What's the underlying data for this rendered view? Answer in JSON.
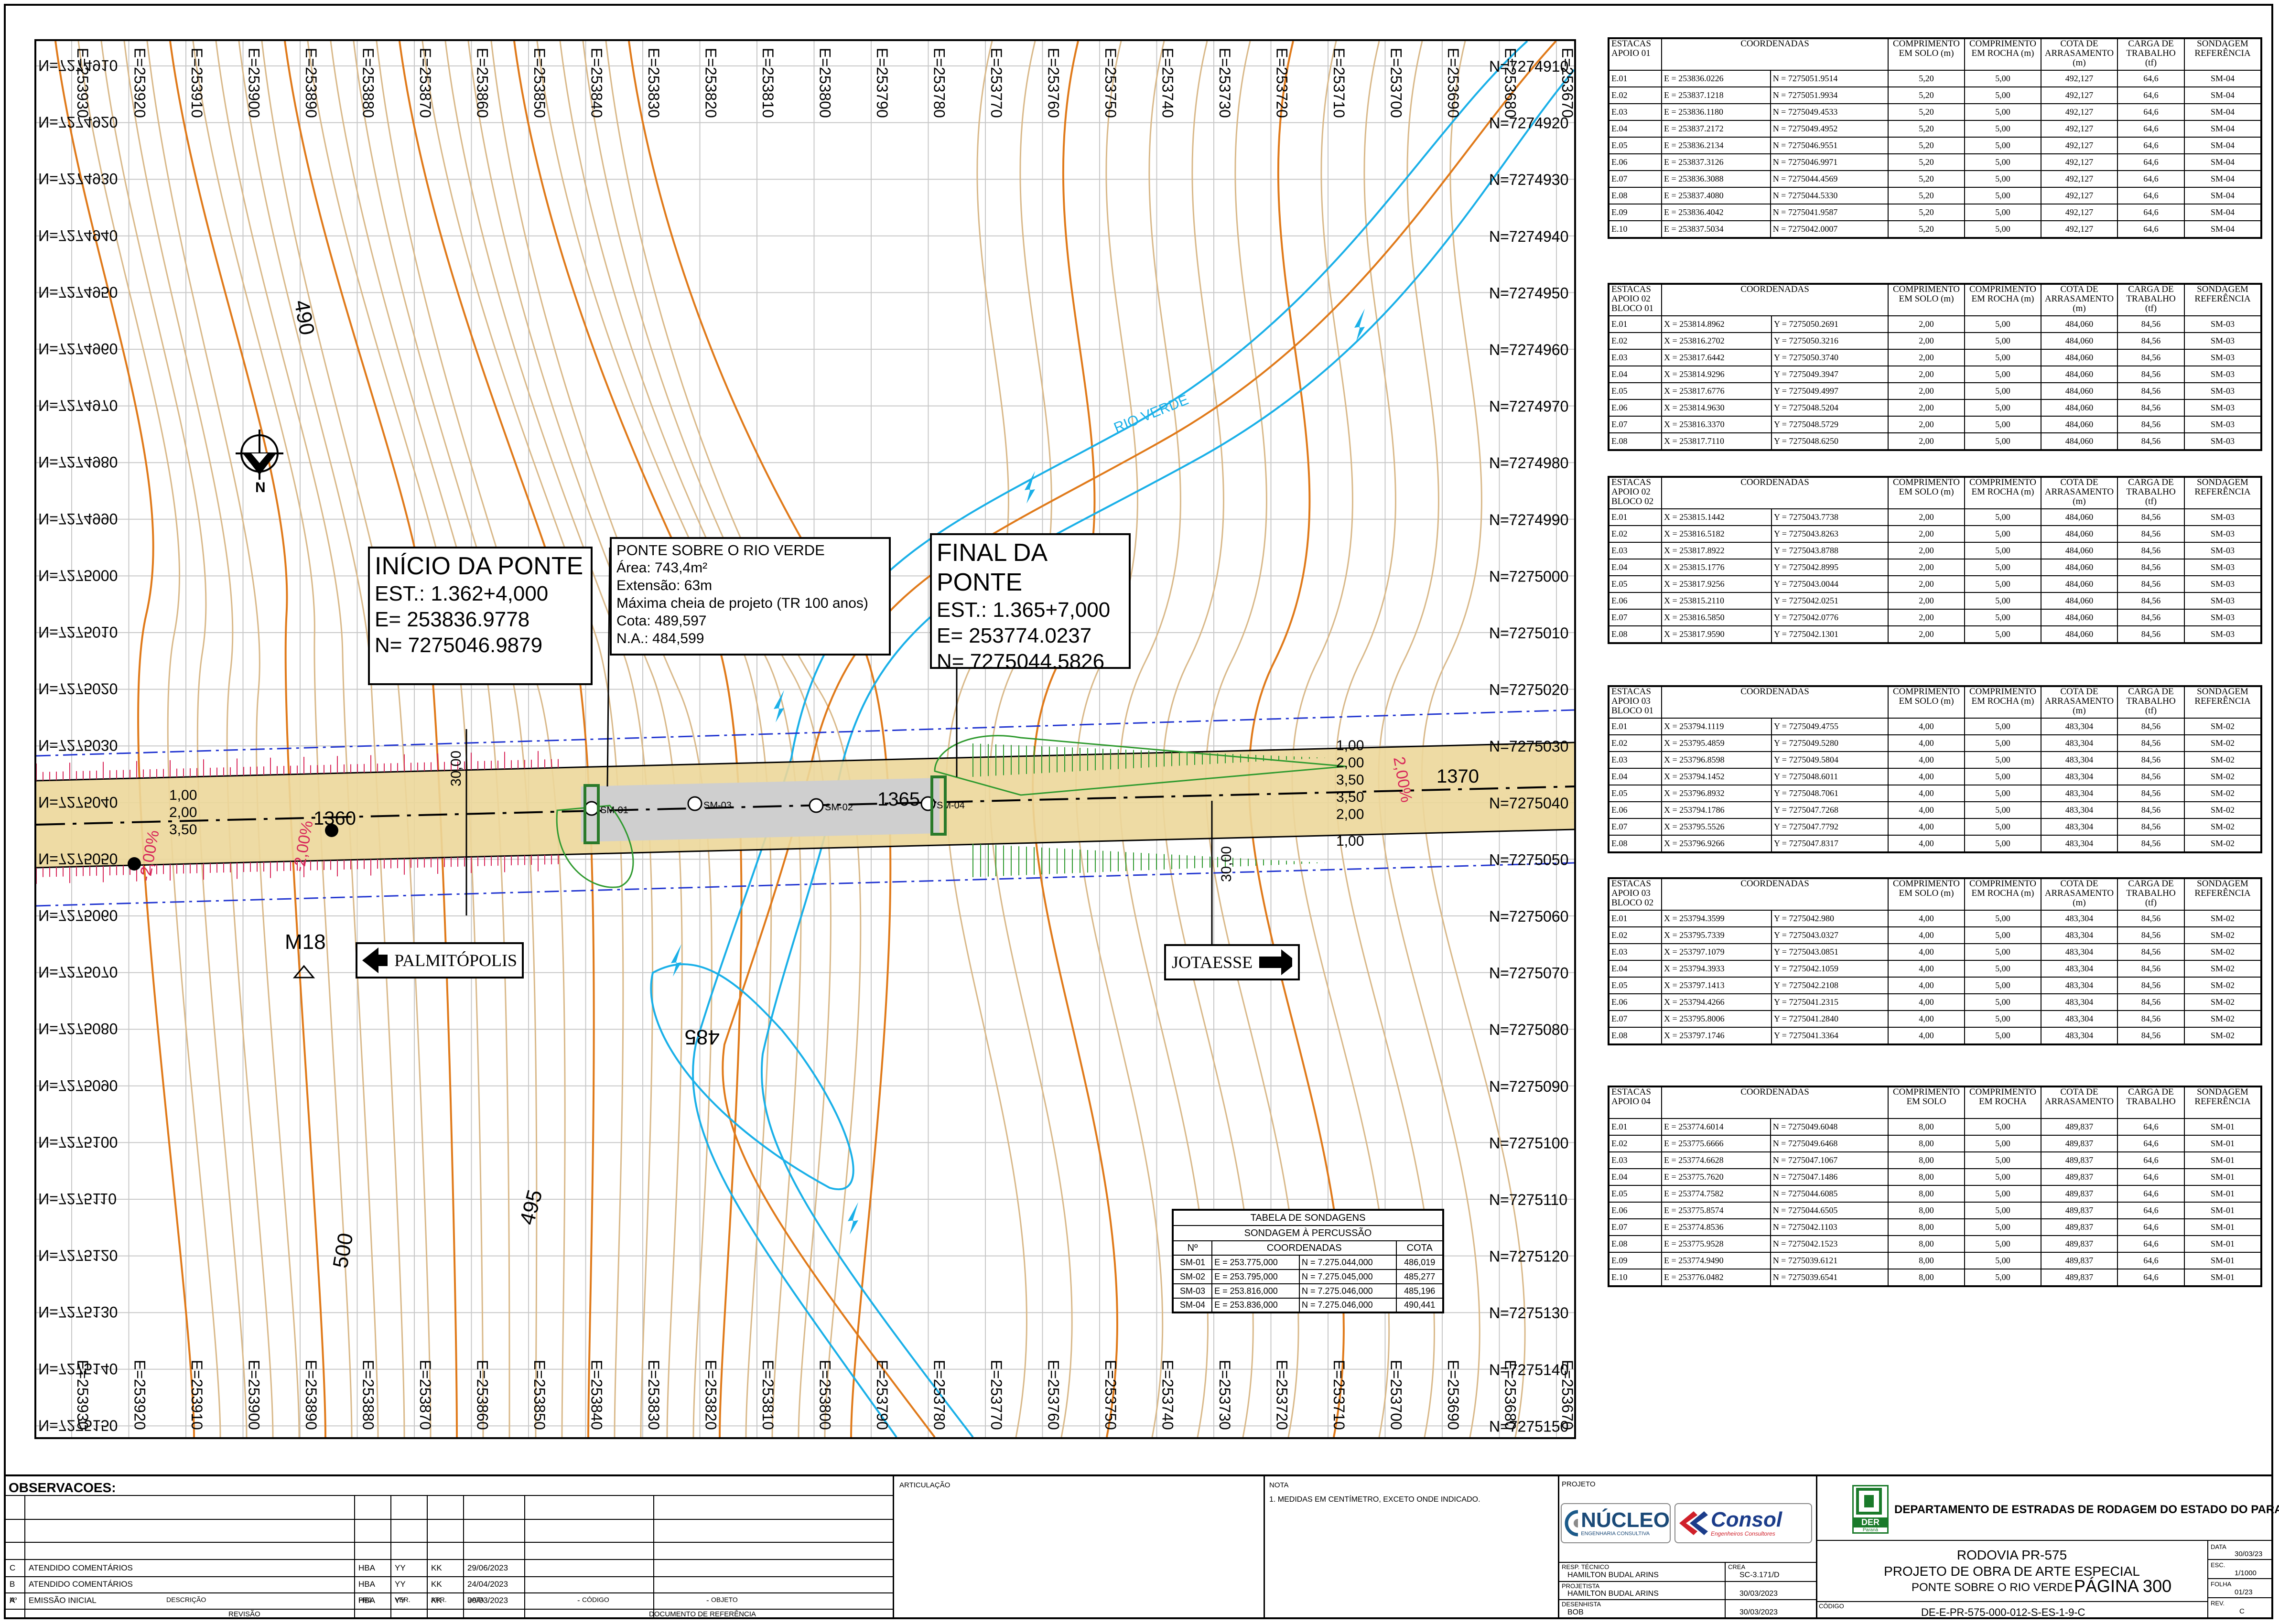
{
  "map": {
    "easting_labels": [
      "E=253930",
      "E=253920",
      "E=253910",
      "E=253900",
      "E=253890",
      "E=253880",
      "E=253870",
      "E=253860",
      "E=253850",
      "E=253840",
      "E=253830",
      "E=253820",
      "E=253810",
      "E=253800",
      "E=253790",
      "E=253780",
      "E=253770",
      "E=253760",
      "E=253750",
      "E=253740",
      "E=253730",
      "E=253720",
      "E=253710",
      "E=253700",
      "E=253690",
      "E=253680",
      "E=253670"
    ],
    "northing_labels": [
      "N=7274910",
      "N=7274920",
      "N=7274930",
      "N=7274940",
      "N=7274950",
      "N=7274960",
      "N=7274970",
      "N=7274980",
      "N=7274990",
      "N=7275000",
      "N=7275010",
      "N=7275020",
      "N=7275030",
      "N=7275040",
      "N=7275050",
      "N=7275060",
      "N=7275070",
      "N=7275080",
      "N=7275090",
      "N=7275100",
      "N=7275110",
      "N=7275120",
      "N=7275130",
      "N=7275140",
      "N=7275150"
    ],
    "river_label": "RIO VERDE",
    "contour_labels": [
      "490",
      "485",
      "495",
      "500"
    ],
    "station_labels": [
      "1360",
      "1365",
      "1370"
    ],
    "benchmark": "M18",
    "direction_left": "PALMITÓPOLIS",
    "direction_right": "JOTAESSE",
    "north_label": "N",
    "road_dims_left": [
      "1,00",
      "2,00",
      "3,50"
    ],
    "road_dims_right": [
      "1,00",
      "2,00",
      "3,50",
      "3,50",
      "2,00",
      "1,00"
    ],
    "slope_labels": [
      "-2,00%",
      "-2,00%",
      "2,00%",
      "-2,00%"
    ],
    "dim_30": "30,00",
    "boring_labels": [
      "SM-04",
      "SM-03",
      "SM-02",
      "SM-01"
    ],
    "inicio": {
      "title": "INÍCIO DA PONTE",
      "est": "EST.: 1.362+4,000",
      "e": "E= 253836.9778",
      "n": "N= 7275046.9879"
    },
    "ponte": {
      "title": "PONTE SOBRE O RIO VERDE",
      "area": "Área: 743,4m²",
      "ext": "Extensão: 63m",
      "cheia": "Máxima cheia de projeto (TR 100 anos)",
      "cota": "Cota: 489,597",
      "na": "N.A.: 484,599"
    },
    "final": {
      "title": "FINAL DA PONTE",
      "est": "EST.: 1.365+7,000",
      "e": "E= 253774.0237",
      "n": "N= 7275044.5826"
    },
    "sondagens": {
      "title": "TABELA DE SONDAGENS",
      "subtitle": "SONDAGEM À PERCUSSÃO",
      "headers": [
        "Nº",
        "COORDENADAS",
        "COTA"
      ],
      "rows": [
        [
          "SM-01",
          "E = 253.775,000",
          "N = 7.275.044,000",
          "486,019"
        ],
        [
          "SM-02",
          "E = 253.795,000",
          "N = 7.275.045,000",
          "485,277"
        ],
        [
          "SM-03",
          "E = 253.816,000",
          "N = 7.275.046,000",
          "485,196"
        ],
        [
          "SM-04",
          "E = 253.836,000",
          "N = 7.275.046,000",
          "490,441"
        ]
      ]
    }
  },
  "tables": [
    {
      "title": "ESTACAS APOIO 01",
      "h5": "CARGA DE TRABALHO (tf)",
      "rows": [
        [
          "E.01",
          "E = 253836.0226",
          "N = 7275051.9514",
          "5,20",
          "5,00",
          "492,127",
          "64,6",
          "SM-04"
        ],
        [
          "E.02",
          "E = 253837.1218",
          "N = 7275051.9934",
          "5,20",
          "5,00",
          "492,127",
          "64,6",
          "SM-04"
        ],
        [
          "E.03",
          "E = 253836.1180",
          "N = 7275049.4533",
          "5,20",
          "5,00",
          "492,127",
          "64,6",
          "SM-04"
        ],
        [
          "E.04",
          "E = 253837.2172",
          "N = 7275049.4952",
          "5,20",
          "5,00",
          "492,127",
          "64,6",
          "SM-04"
        ],
        [
          "E.05",
          "E = 253836.2134",
          "N = 7275046.9551",
          "5,20",
          "5,00",
          "492,127",
          "64,6",
          "SM-04"
        ],
        [
          "E.06",
          "E = 253837.3126",
          "N = 7275046.9971",
          "5,20",
          "5,00",
          "492,127",
          "64,6",
          "SM-04"
        ],
        [
          "E.07",
          "E = 253836.3088",
          "N = 7275044.4569",
          "5,20",
          "5,00",
          "492,127",
          "64,6",
          "SM-04"
        ],
        [
          "E.08",
          "E = 253837.4080",
          "N = 7275044.5330",
          "5,20",
          "5,00",
          "492,127",
          "64,6",
          "SM-04"
        ],
        [
          "E.09",
          "E = 253836.4042",
          "N = 7275041.9587",
          "5,20",
          "5,00",
          "492,127",
          "64,6",
          "SM-04"
        ],
        [
          "E.10",
          "E = 253837.5034",
          "N = 7275042.0007",
          "5,20",
          "5,00",
          "492,127",
          "64,6",
          "SM-04"
        ]
      ]
    },
    {
      "title": "ESTACAS APOIO 02 BLOCO 01",
      "h5": "CARGA DE TRABALHO (tf)",
      "rows": [
        [
          "E.01",
          "X = 253814.8962",
          "Y = 7275050.2691",
          "2,00",
          "5,00",
          "484,060",
          "84,56",
          "SM-03"
        ],
        [
          "E.02",
          "X = 253816.2702",
          "Y = 7275050.3216",
          "2,00",
          "5,00",
          "484,060",
          "84,56",
          "SM-03"
        ],
        [
          "E.03",
          "X = 253817.6442",
          "Y = 7275050.3740",
          "2,00",
          "5,00",
          "484,060",
          "84,56",
          "SM-03"
        ],
        [
          "E.04",
          "X = 253814.9296",
          "Y = 7275049.3947",
          "2,00",
          "5,00",
          "484,060",
          "84,56",
          "SM-03"
        ],
        [
          "E.05",
          "X = 253817.6776",
          "Y = 7275049.4997",
          "2,00",
          "5,00",
          "484,060",
          "84,56",
          "SM-03"
        ],
        [
          "E.06",
          "X = 253814.9630",
          "Y = 7275048.5204",
          "2,00",
          "5,00",
          "484,060",
          "84,56",
          "SM-03"
        ],
        [
          "E.07",
          "X = 253816.3370",
          "Y = 7275048.5729",
          "2,00",
          "5,00",
          "484,060",
          "84,56",
          "SM-03"
        ],
        [
          "E.08",
          "X = 253817.7110",
          "Y = 7275048.6250",
          "2,00",
          "5,00",
          "484,060",
          "84,56",
          "SM-03"
        ]
      ]
    },
    {
      "title": "ESTACAS APOIO 02 BLOCO 02",
      "h5": "CARGA DE TRABALHO (tf)",
      "rows": [
        [
          "E.01",
          "X = 253815.1442",
          "Y = 7275043.7738",
          "2,00",
          "5,00",
          "484,060",
          "84,56",
          "SM-03"
        ],
        [
          "E.02",
          "X = 253816.5182",
          "Y = 7275043.8263",
          "2,00",
          "5,00",
          "484,060",
          "84,56",
          "SM-03"
        ],
        [
          "E.03",
          "X = 253817.8922",
          "Y = 7275043.8788",
          "2,00",
          "5,00",
          "484,060",
          "84,56",
          "SM-03"
        ],
        [
          "E.04",
          "X = 253815.1776",
          "Y = 7275042.8995",
          "2,00",
          "5,00",
          "484,060",
          "84,56",
          "SM-03"
        ],
        [
          "E.05",
          "X = 253817.9256",
          "Y = 7275043.0044",
          "2,00",
          "5,00",
          "484,060",
          "84,56",
          "SM-03"
        ],
        [
          "E.06",
          "X = 253815.2110",
          "Y = 7275042.0251",
          "2,00",
          "5,00",
          "484,060",
          "84,56",
          "SM-03"
        ],
        [
          "E.07",
          "X = 253816.5850",
          "Y = 7275042.0776",
          "2,00",
          "5,00",
          "484,060",
          "84,56",
          "SM-03"
        ],
        [
          "E.08",
          "X = 253817.9590",
          "Y = 7275042.1301",
          "2,00",
          "5,00",
          "484,060",
          "84,56",
          "SM-03"
        ]
      ]
    },
    {
      "title": "ESTACAS APOIO 03 BLOCO 01",
      "h5": "CARGA DE TRABALHO (tf)",
      "rows": [
        [
          "E.01",
          "X = 253794.1119",
          "Y = 7275049.4755",
          "4,00",
          "5,00",
          "483,304",
          "84,56",
          "SM-02"
        ],
        [
          "E.02",
          "X = 253795.4859",
          "Y = 7275049.5280",
          "4,00",
          "5,00",
          "483,304",
          "84,56",
          "SM-02"
        ],
        [
          "E.03",
          "X = 253796.8598",
          "Y = 7275049.5804",
          "4,00",
          "5,00",
          "483,304",
          "84,56",
          "SM-02"
        ],
        [
          "E.04",
          "X = 253794.1452",
          "Y = 7275048.6011",
          "4,00",
          "5,00",
          "483,304",
          "84,56",
          "SM-02"
        ],
        [
          "E.05",
          "X = 253796.8932",
          "Y = 7275048.7061",
          "4,00",
          "5,00",
          "483,304",
          "84,56",
          "SM-02"
        ],
        [
          "E.06",
          "X = 253794.1786",
          "Y = 7275047.7268",
          "4,00",
          "5,00",
          "483,304",
          "84,56",
          "SM-02"
        ],
        [
          "E.07",
          "X = 253795.5526",
          "Y = 7275047.7792",
          "4,00",
          "5,00",
          "483,304",
          "84,56",
          "SM-02"
        ],
        [
          "E.08",
          "X = 253796.9266",
          "Y = 7275047.8317",
          "4,00",
          "5,00",
          "483,304",
          "84,56",
          "SM-02"
        ]
      ]
    },
    {
      "title": "ESTACAS APOIO 03 BLOCO 02",
      "h5": "CARGA DE TRABALHO (tf)",
      "rows": [
        [
          "E.01",
          "X = 253794.3599",
          "Y = 7275042.980",
          "4,00",
          "5,00",
          "483,304",
          "84,56",
          "SM-02"
        ],
        [
          "E.02",
          "X = 253795.7339",
          "Y = 7275043.0327",
          "4,00",
          "5,00",
          "483,304",
          "84,56",
          "SM-02"
        ],
        [
          "E.03",
          "X = 253797.1079",
          "Y = 7275043.0851",
          "4,00",
          "5,00",
          "483,304",
          "84,56",
          "SM-02"
        ],
        [
          "E.04",
          "X = 253794.3933",
          "Y = 7275042.1059",
          "4,00",
          "5,00",
          "483,304",
          "84,56",
          "SM-02"
        ],
        [
          "E.05",
          "X = 253797.1413",
          "Y = 7275042.2108",
          "4,00",
          "5,00",
          "483,304",
          "84,56",
          "SM-02"
        ],
        [
          "E.06",
          "X = 253794.4266",
          "Y = 7275041.2315",
          "4,00",
          "5,00",
          "483,304",
          "84,56",
          "SM-02"
        ],
        [
          "E.07",
          "X = 253795.8006",
          "Y = 7275041.2840",
          "4,00",
          "5,00",
          "483,304",
          "84,56",
          "SM-02"
        ],
        [
          "E.08",
          "X = 253797.1746",
          "Y = 7275041.3364",
          "4,00",
          "5,00",
          "483,304",
          "84,56",
          "SM-02"
        ]
      ]
    },
    {
      "title": "ESTACAS APOIO 04",
      "h5": "CARGA DE TRABALHO",
      "rows": [
        [
          "E.01",
          "E = 253774.6014",
          "N = 7275049.6048",
          "8,00",
          "5,00",
          "489,837",
          "64,6",
          "SM-01"
        ],
        [
          "E.02",
          "E = 253775.6666",
          "N = 7275049.6468",
          "8,00",
          "5,00",
          "489,837",
          "64,6",
          "SM-01"
        ],
        [
          "E.03",
          "E = 253774.6628",
          "N = 7275047.1067",
          "8,00",
          "5,00",
          "489,837",
          "64,6",
          "SM-01"
        ],
        [
          "E.04",
          "E = 253775.7620",
          "N = 7275047.1486",
          "8,00",
          "5,00",
          "489,837",
          "64,6",
          "SM-01"
        ],
        [
          "E.05",
          "E = 253774.7582",
          "N = 7275044.6085",
          "8,00",
          "5,00",
          "489,837",
          "64,6",
          "SM-01"
        ],
        [
          "E.06",
          "E = 253775.8574",
          "N = 7275044.6505",
          "8,00",
          "5,00",
          "489,837",
          "64,6",
          "SM-01"
        ],
        [
          "E.07",
          "E = 253774.8536",
          "N = 7275042.1103",
          "8,00",
          "5,00",
          "489,837",
          "64,6",
          "SM-01"
        ],
        [
          "E.08",
          "E = 253775.9528",
          "N = 7275042.1523",
          "8,00",
          "5,00",
          "489,837",
          "64,6",
          "SM-01"
        ],
        [
          "E.09",
          "E = 253774.9490",
          "N = 7275039.6121",
          "8,00",
          "5,00",
          "489,837",
          "64,6",
          "SM-01"
        ],
        [
          "E.10",
          "E = 253776.0482",
          "N = 7275039.6541",
          "8,00",
          "5,00",
          "489,837",
          "64,6",
          "SM-01"
        ]
      ]
    }
  ],
  "table_headers": {
    "coord": "COORDENADAS",
    "solo": "COMPRIMENTO EM SOLO (m)",
    "rocha": "COMPRIMENTO EM ROCHA (m)",
    "cota": "COTA DE ARRASAMENTO (m)",
    "sond": "SONDAGEM REFERÊNCIA",
    "solo_short": "COMPRIMENTO EM SOLO",
    "rocha_short": "COMPRIMENTO EM ROCHA",
    "cota_short": "COTA DE ARRASAMENTO"
  },
  "title_block": {
    "observacoes": "OBSERVACOES:",
    "revisions": [
      [
        "C",
        "ATENDIDO COMENTÁRIOS",
        "HBA",
        "YY",
        "KK",
        "29/06/2023",
        "",
        ""
      ],
      [
        "B",
        "ATENDIDO COMENTÁRIOS",
        "HBA",
        "YY",
        "KK",
        "24/04/2023",
        "",
        ""
      ],
      [
        "A",
        "EMISSÃO INICIAL",
        "HBA",
        "YY",
        "KK",
        "30/03/2023",
        "-",
        "-"
      ]
    ],
    "rev_headers": [
      "Nº",
      "DESCRIÇÃO",
      "PRJ.",
      "VER.",
      "APR.",
      "DATA",
      "CÓDIGO",
      "OBJETO"
    ],
    "revisao": "REVISÃO",
    "doc_ref": "DOCUMENTO DE REFERÊNCIA",
    "articulacao": "ARTICULAÇÃO",
    "nota_label": "NOTA",
    "nota": "1.   MEDIDAS EM CENTÍMETRO, EXCETO ONDE INDICADO.",
    "projeto_label": "PROJETO",
    "nucleo": "NÚCLEO",
    "nucleo_sub": "ENGENHARIA CONSULTIVA",
    "consol": "Consol",
    "consol_sub": "Engenheiros Consultores",
    "resp_tecnico_label": "RESP. TÉCNICO",
    "resp_tecnico": "HAMILTON BUDAL ARINS",
    "crea_label": "CREA",
    "crea": "SC-3.171/D",
    "projetista_label": "PROJETISTA",
    "projetista": "HAMILTON BUDAL ARINS",
    "projetista_date": "30/03/2023",
    "desenhista_label": "DESENHISTA",
    "desenhista": "BOB",
    "desenhista_date": "30/03/2023",
    "codigo_label": "CÓDIGO",
    "codigo": "DE-E-PR-575-000-012-S-ES-1-9-C",
    "der": "DER",
    "der_sub": "Paraná",
    "department": "DEPARTAMENTO DE ESTRADAS DE RODAGEM DO ESTADO DO PARANÁ",
    "rodovia": "RODOVIA PR-575",
    "projeto": "PROJETO DE OBRA DE ARTE ESPECIAL",
    "ponte": "PONTE SOBRE O RIO VERDE",
    "pagina": "PÁGINA 300",
    "data_label": "DATA",
    "data": "30/03/23",
    "esc_label": "ESC.",
    "esc": "1/1000",
    "folha_label": "FOLHA",
    "folha": "01/23",
    "rev_label": "REV.",
    "rev": "C"
  },
  "colors": {
    "grid": "#c8c8c8",
    "contour": "#d9b98a",
    "contour_major": "#e07a1a",
    "river": "#1ab0e8",
    "road": "#ecd79a",
    "bridge": "#cfcfcf",
    "fill_green": "#2f9a2f",
    "fill_red": "#d8285a",
    "dash_blue": "#2034d0"
  }
}
